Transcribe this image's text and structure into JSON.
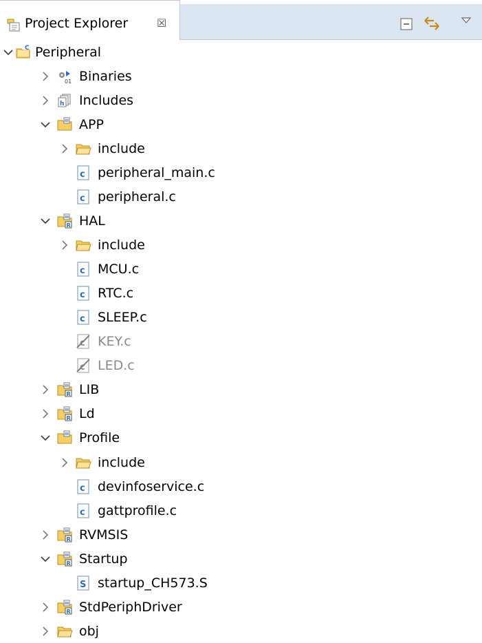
{
  "view": {
    "title": "Project Explorer",
    "close_glyph": "☒"
  },
  "toolbar": {
    "collapse_icon": "collapse-all-icon",
    "link_icon": "link-with-editor-icon",
    "menu_icon": "view-menu-icon"
  },
  "tree": [
    {
      "label": "Peripheral",
      "depth": 0,
      "toggle": "expanded",
      "icon": "c-project-icon"
    },
    {
      "label": "Binaries",
      "depth": 1,
      "toggle": "collapsed",
      "icon": "binaries-icon"
    },
    {
      "label": "Includes",
      "depth": 1,
      "toggle": "collapsed",
      "icon": "includes-icon"
    },
    {
      "label": "APP",
      "depth": 1,
      "toggle": "expanded",
      "icon": "source-folder-icon"
    },
    {
      "label": "include",
      "depth": 2,
      "toggle": "collapsed",
      "icon": "folder-icon"
    },
    {
      "label": "peripheral_main.c",
      "depth": 2,
      "toggle": "none",
      "icon": "c-file-icon"
    },
    {
      "label": "peripheral.c",
      "depth": 2,
      "toggle": "none",
      "icon": "c-file-icon"
    },
    {
      "label": "HAL",
      "depth": 1,
      "toggle": "expanded",
      "icon": "linked-source-folder-icon"
    },
    {
      "label": "include",
      "depth": 2,
      "toggle": "collapsed",
      "icon": "folder-icon"
    },
    {
      "label": "MCU.c",
      "depth": 2,
      "toggle": "none",
      "icon": "c-file-icon"
    },
    {
      "label": "RTC.c",
      "depth": 2,
      "toggle": "none",
      "icon": "c-file-icon"
    },
    {
      "label": "SLEEP.c",
      "depth": 2,
      "toggle": "none",
      "icon": "c-file-icon"
    },
    {
      "label": "KEY.c",
      "depth": 2,
      "toggle": "none",
      "icon": "excluded-file-icon",
      "excluded": true
    },
    {
      "label": "LED.c",
      "depth": 2,
      "toggle": "none",
      "icon": "excluded-file-icon",
      "excluded": true
    },
    {
      "label": "LIB",
      "depth": 1,
      "toggle": "collapsed",
      "icon": "linked-source-folder-icon"
    },
    {
      "label": "Ld",
      "depth": 1,
      "toggle": "collapsed",
      "icon": "linked-source-folder-icon"
    },
    {
      "label": "Profile",
      "depth": 1,
      "toggle": "expanded",
      "icon": "source-folder-icon"
    },
    {
      "label": "include",
      "depth": 2,
      "toggle": "collapsed",
      "icon": "folder-icon"
    },
    {
      "label": "devinfoservice.c",
      "depth": 2,
      "toggle": "none",
      "icon": "c-file-icon"
    },
    {
      "label": "gattprofile.c",
      "depth": 2,
      "toggle": "none",
      "icon": "c-file-icon"
    },
    {
      "label": "RVMSIS",
      "depth": 1,
      "toggle": "collapsed",
      "icon": "linked-source-folder-icon"
    },
    {
      "label": "Startup",
      "depth": 1,
      "toggle": "expanded",
      "icon": "linked-source-folder-icon"
    },
    {
      "label": "startup_CH573.S",
      "depth": 2,
      "toggle": "none",
      "icon": "asm-file-icon"
    },
    {
      "label": "StdPeriphDriver",
      "depth": 1,
      "toggle": "collapsed",
      "icon": "linked-source-folder-icon"
    },
    {
      "label": "obj",
      "depth": 1,
      "toggle": "collapsed",
      "icon": "folder-icon"
    }
  ],
  "colors": {
    "tab_strip": "#dce6f3",
    "tab_border": "#b9c8dc",
    "folder_yellow": "#f4cf66",
    "folder_outline": "#b98d1e",
    "file_blue": "#2f6db5",
    "excluded_text": "#8a8a8a"
  }
}
